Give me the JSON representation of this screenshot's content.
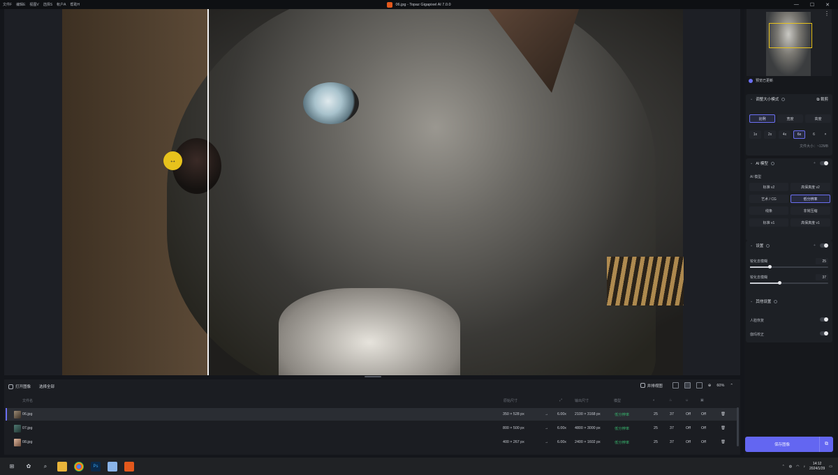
{
  "menu": [
    "文件F",
    "编辑E",
    "视图V",
    "选择S",
    "帐户A",
    "帮助H"
  ],
  "window": {
    "title": "06.jpg - Topaz Gigapixel AI 7.0.0",
    "min": "—",
    "max": "☐",
    "close": "✕"
  },
  "viewer": {
    "handle_icon": "↔"
  },
  "bottom": {
    "open_image": "打开图像",
    "select_all": "选择全部",
    "compare_view": "并排视图",
    "zoom": "60%",
    "headers": {
      "filename": "文件名",
      "input_size": "原始尺寸",
      "output_size": "输出尺寸",
      "model": "模型"
    },
    "rows": [
      {
        "name": "06.jpg",
        "input": "350 × 528 px",
        "arrow": "→",
        "scale": "6.00x",
        "output": "2100 × 3168 px",
        "model": "低分辨率",
        "c1": "25",
        "c2": "37",
        "c3": "Off",
        "c4": "Off"
      },
      {
        "name": "07.jpg",
        "input": "800 × 500 px",
        "arrow": "→",
        "scale": "6.00x",
        "output": "4800 × 3000 px",
        "model": "低分辨率",
        "c1": "25",
        "c2": "37",
        "c3": "Off",
        "c4": "Off"
      },
      {
        "name": "08.jpg",
        "input": "400 × 267 px",
        "arrow": "→",
        "scale": "6.00x",
        "output": "2400 × 1602 px",
        "model": "低分辨率",
        "c1": "25",
        "c2": "37",
        "c3": "Off",
        "c4": "Off"
      }
    ]
  },
  "right": {
    "preview_checkbox": "预览已更新",
    "resize": {
      "title": "调整大小模式",
      "crop": "裁剪",
      "modes": [
        "比例",
        "宽度",
        "高度"
      ],
      "scales": [
        "1x",
        "2x",
        "4x",
        "6x",
        "6",
        "×"
      ],
      "filesize": "文件大小：~12MB"
    },
    "ai": {
      "title": "AI 模型",
      "subtitle": "AI 模型",
      "models": [
        "标准 v2",
        "高保真度 v2",
        "艺术 / CG",
        "低分辨率",
        "线条",
        "非常压缩",
        "标准 v1",
        "高保真度 v1"
      ]
    },
    "settings": {
      "title": "设置",
      "sharpen_label": "锐化去模糊",
      "sharpen_value": "25",
      "denoise_label": "锐化去模糊",
      "denoise_value": "37"
    },
    "other": {
      "title": "其他设置",
      "face": "人脸恢复",
      "gamma": "伽玛校正"
    },
    "save": "保存图像",
    "save_side": "⧉"
  },
  "taskbar": {
    "time": "14:12",
    "date": "2024/1/29"
  }
}
